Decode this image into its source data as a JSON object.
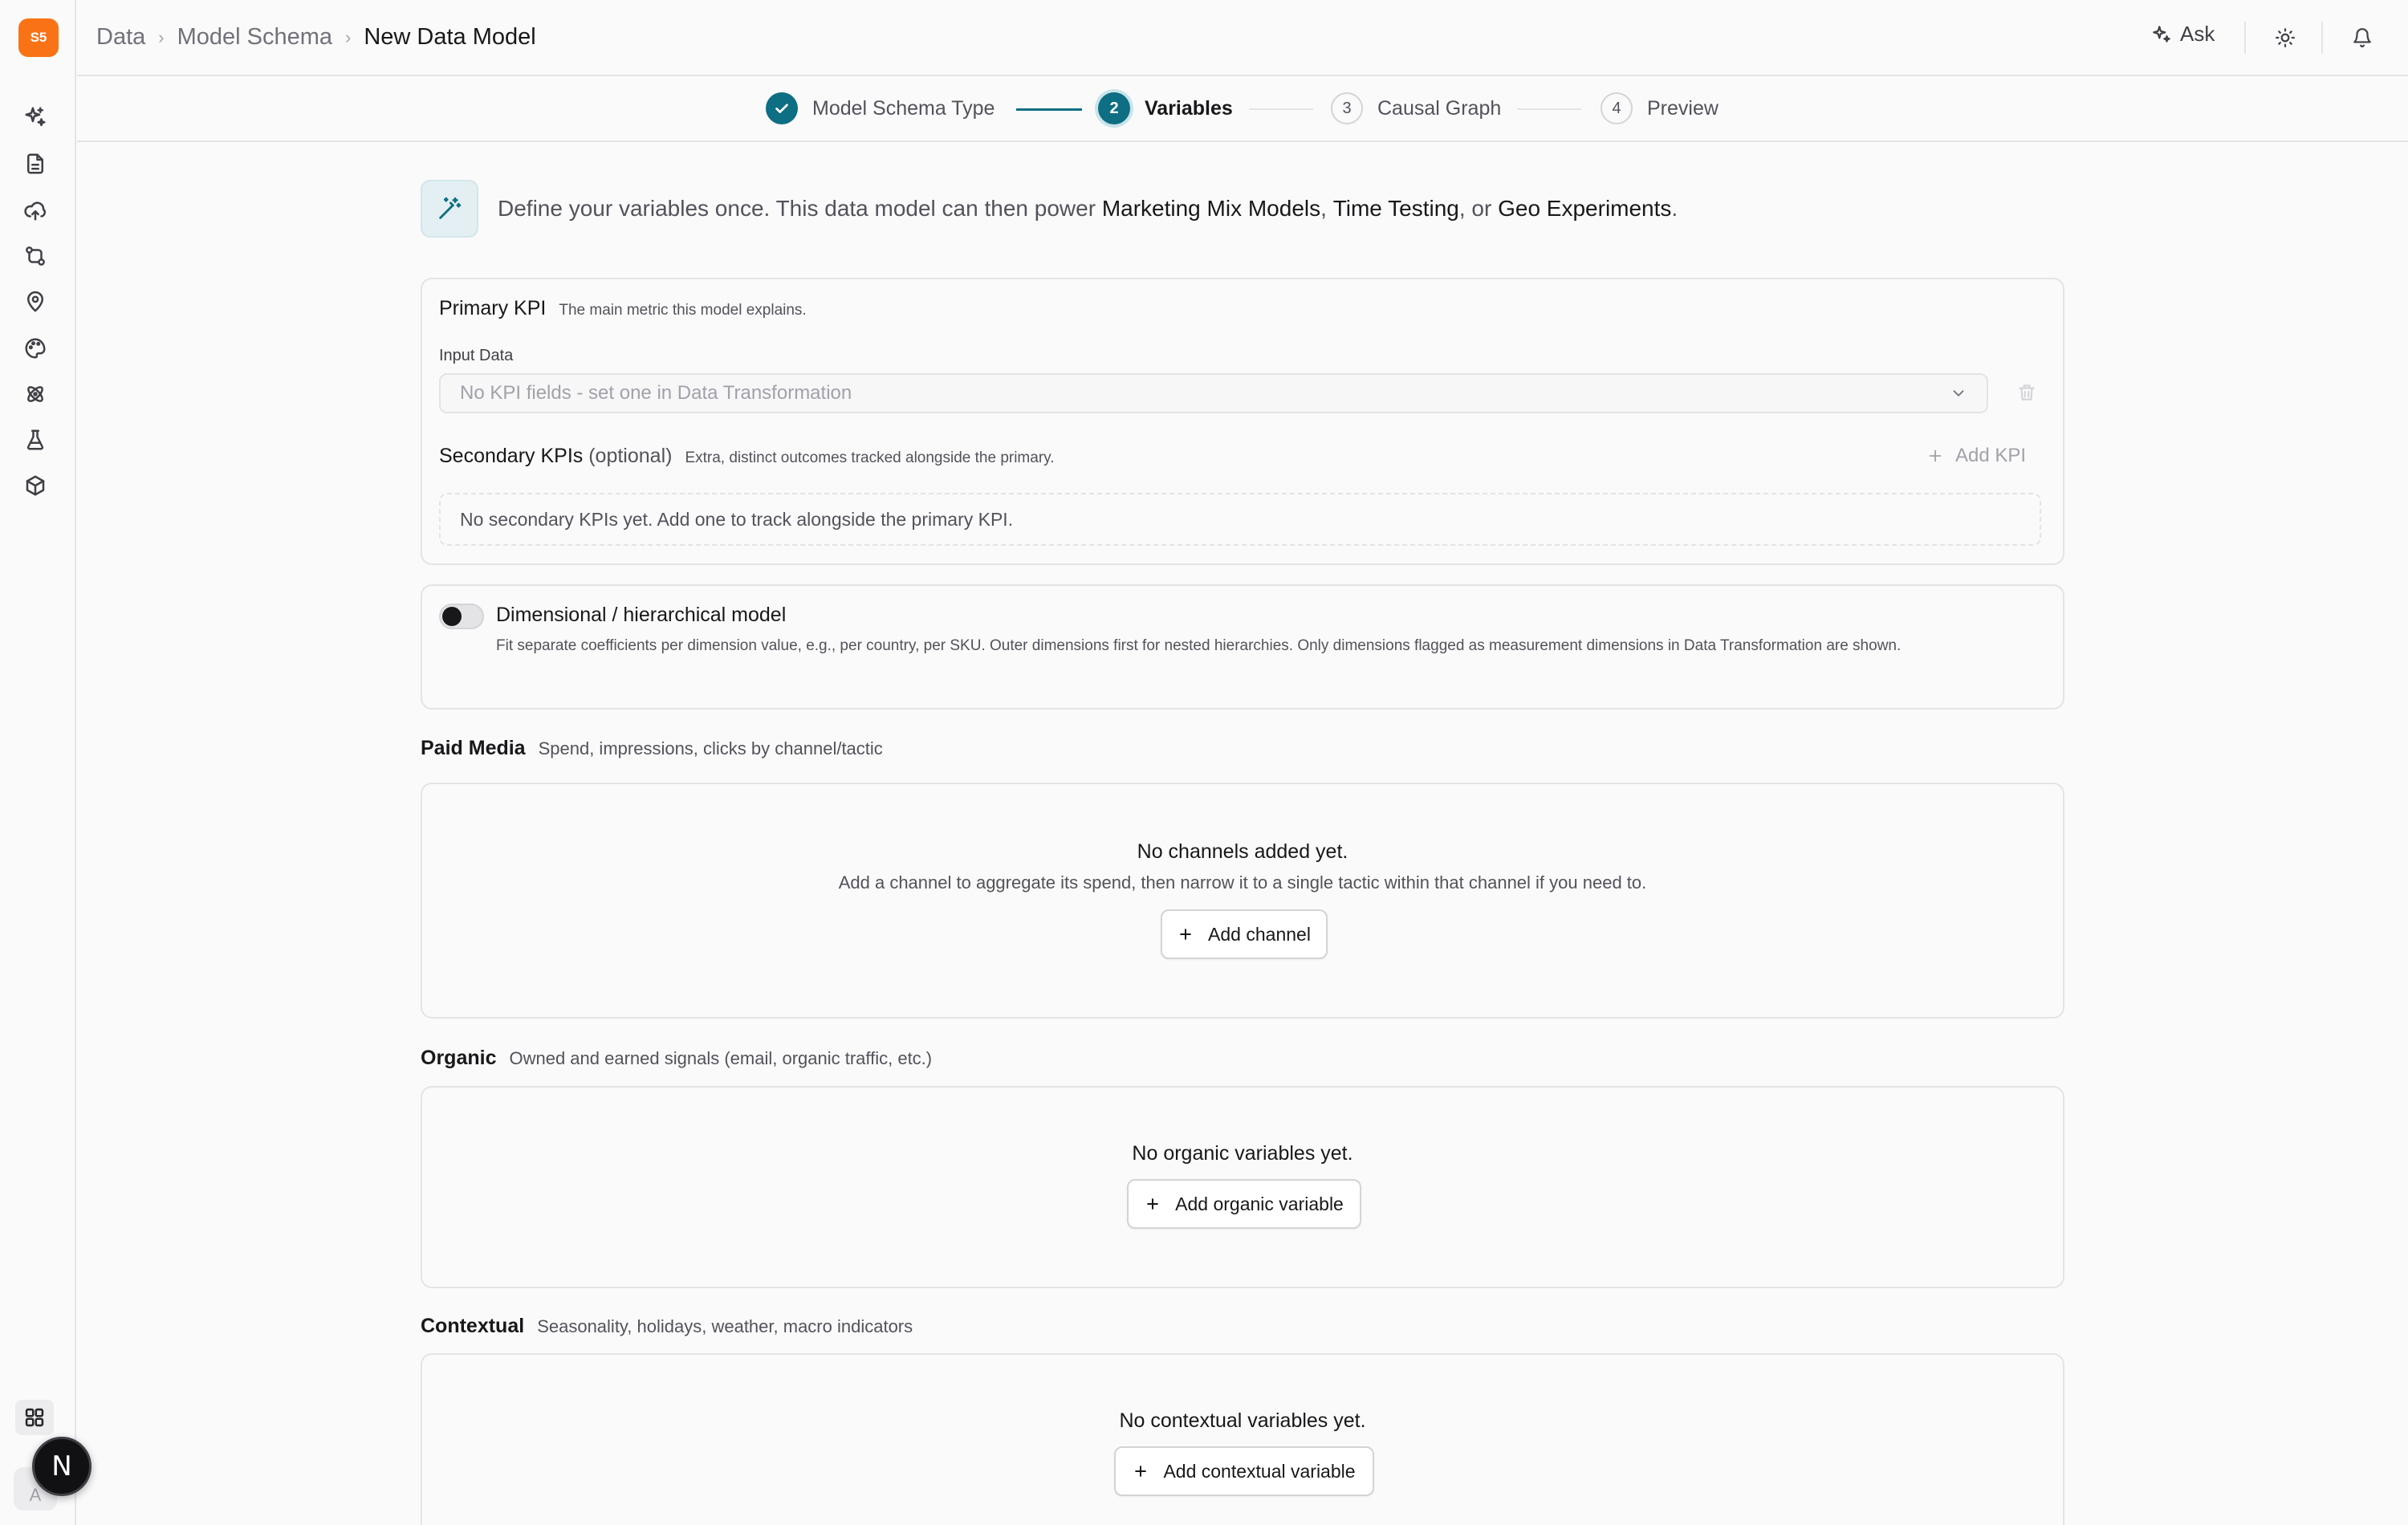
{
  "app": {
    "logo_text": "S5"
  },
  "sidebar": {
    "items": [
      {
        "name": "sparkles-icon"
      },
      {
        "name": "document-icon"
      },
      {
        "name": "cloud-upload-icon"
      },
      {
        "name": "git-compare-icon"
      },
      {
        "name": "map-pin-icon"
      },
      {
        "name": "palette-icon"
      },
      {
        "name": "atom-icon"
      },
      {
        "name": "flask-icon"
      },
      {
        "name": "box-icon"
      }
    ],
    "apps_icon": "grid-icon",
    "avatar_letter": "A",
    "n_badge": "N"
  },
  "header": {
    "breadcrumbs": [
      "Data",
      "Model Schema",
      "New Data Model"
    ],
    "ask_label": "Ask"
  },
  "stepper": {
    "steps": [
      {
        "number": "1",
        "label": "Model Schema Type",
        "state": "done"
      },
      {
        "number": "2",
        "label": "Variables",
        "state": "active"
      },
      {
        "number": "3",
        "label": "Causal Graph",
        "state": "todo"
      },
      {
        "number": "4",
        "label": "Preview",
        "state": "todo"
      }
    ]
  },
  "intro": {
    "text_before": "Define your variables once. This data model can then power ",
    "link1": "Marketing Mix Models",
    "sep1": ", ",
    "link2": "Time Testing",
    "sep2": ", or ",
    "link3": "Geo Experiments",
    "text_after": "."
  },
  "primary_kpi": {
    "title": "Primary KPI",
    "description": "The main metric this model explains.",
    "input_label": "Input Data",
    "select_placeholder": "No KPI fields - set one in Data Transformation"
  },
  "secondary_kpis": {
    "title": "Secondary KPIs",
    "optional": "(optional)",
    "description": "Extra, distinct outcomes tracked alongside the primary.",
    "add_label": "Add KPI",
    "empty_text": "No secondary KPIs yet. Add one to track alongside the primary KPI."
  },
  "dimensional": {
    "title": "Dimensional / hierarchical model",
    "description": "Fit separate coefficients per dimension value, e.g., per country, per SKU. Outer dimensions first for nested hierarchies. Only dimensions flagged as measurement dimensions in Data Transformation are shown.",
    "enabled": false
  },
  "paid_media": {
    "title": "Paid Media",
    "description": "Spend, impressions, clicks by channel/tactic",
    "empty_title": "No channels added yet.",
    "empty_sub": "Add a channel to aggregate its spend, then narrow it to a single tactic within that channel if you need to.",
    "button": "Add channel"
  },
  "organic": {
    "title": "Organic",
    "description": "Owned and earned signals (email, organic traffic, etc.)",
    "empty_title": "No organic variables yet.",
    "button": "Add organic variable"
  },
  "contextual": {
    "title": "Contextual",
    "description": "Seasonality, holidays, weather, macro indicators",
    "empty_title": "No contextual variables yet.",
    "button": "Add contextual variable"
  },
  "colors": {
    "accent": "#0e6e83",
    "logo": "#f97316",
    "background": "#fafafa",
    "border": "#e4e4e7"
  }
}
